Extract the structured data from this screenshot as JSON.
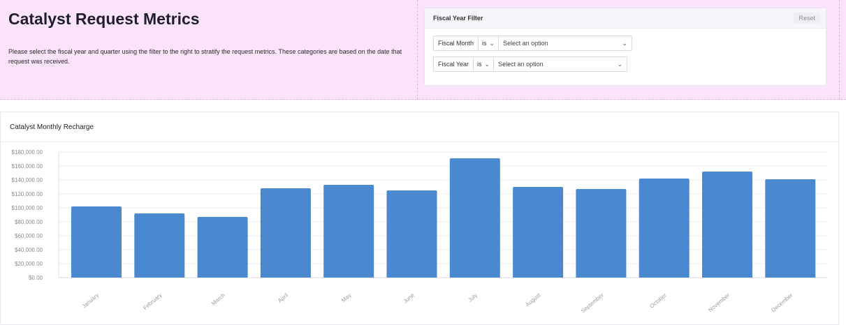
{
  "header": {
    "title": "Catalyst Request Metrics",
    "description": "Please select the fiscal year and quarter using the filter to the right to stratify the request metrics. These categories are based on the date that request was received."
  },
  "filter": {
    "title": "Fiscal Year Filter",
    "reset_label": "Reset",
    "rows": [
      {
        "field": "Fiscal Month",
        "operator": "is",
        "placeholder": "Select an option"
      },
      {
        "field": "Fiscal Year",
        "operator": "is",
        "placeholder": "Select an option"
      }
    ]
  },
  "chart_card": {
    "title": "Catalyst Monthly Recharge"
  },
  "colors": {
    "bar": "#4a89cf",
    "header_band": "#fbe4fb"
  },
  "chart_data": {
    "type": "bar",
    "title": "Catalyst Monthly Recharge",
    "categories": [
      "January",
      "February",
      "March",
      "April",
      "May",
      "June",
      "July",
      "August",
      "September",
      "October",
      "November",
      "December"
    ],
    "values": [
      102000,
      92000,
      87000,
      128000,
      133000,
      125000,
      171000,
      130000,
      127000,
      142000,
      152000,
      141000
    ],
    "ylim": [
      0,
      180000
    ],
    "yticks": [
      "$0.00",
      "$20,000.00",
      "$40,000.00",
      "$60,000.00",
      "$80,000.00",
      "$100,000.00",
      "$120,000.00",
      "$140,000.00",
      "$160,000.00",
      "$180,000.00"
    ],
    "grid": true,
    "xlabel": "",
    "ylabel": ""
  }
}
